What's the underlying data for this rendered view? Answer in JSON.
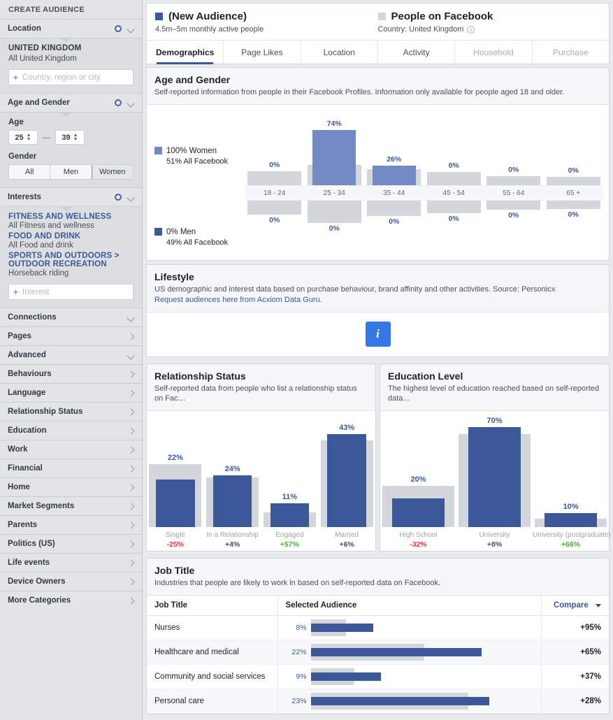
{
  "sidebar": {
    "title": "CREATE AUDIENCE",
    "location": {
      "label": "Location",
      "country_title": "UNITED KINGDOM",
      "country_sub": "All United Kingdom",
      "input_placeholder": "Country, region or city"
    },
    "age_gender": {
      "label": "Age and Gender",
      "age_label": "Age",
      "age_min": "25",
      "age_max": "39",
      "dash": "—",
      "gender_label": "Gender",
      "options": [
        "All",
        "Men",
        "Women"
      ],
      "selected": "Women"
    },
    "interests": {
      "label": "Interests",
      "groups": [
        {
          "category": "FITNESS AND WELLNESS",
          "item": "All Fitness and wellness"
        },
        {
          "category": "FOOD AND DRINK",
          "item": "All Food and drink"
        },
        {
          "category": "SPORTS AND OUTDOORS > OUTDOOR RECREATION",
          "item": "Horseback riding"
        }
      ],
      "input_placeholder": "Interest"
    },
    "sections": [
      {
        "label": "Connections",
        "chevron": "down"
      },
      {
        "label": "Pages",
        "chevron": "right"
      },
      {
        "label": "Advanced",
        "chevron": "down"
      },
      {
        "label": "Behaviours",
        "chevron": "right"
      },
      {
        "label": "Language",
        "chevron": "right"
      },
      {
        "label": "Relationship Status",
        "chevron": "right"
      },
      {
        "label": "Education",
        "chevron": "right"
      },
      {
        "label": "Work",
        "chevron": "right"
      },
      {
        "label": "Financial",
        "chevron": "right"
      },
      {
        "label": "Home",
        "chevron": "right"
      },
      {
        "label": "Market Segments",
        "chevron": "right"
      },
      {
        "label": "Parents",
        "chevron": "right"
      },
      {
        "label": "Politics (US)",
        "chevron": "right"
      },
      {
        "label": "Life events",
        "chevron": "right"
      },
      {
        "label": "Device Owners",
        "chevron": "right"
      },
      {
        "label": "More Categories",
        "chevron": "right"
      }
    ]
  },
  "header": {
    "audience_name": "(New Audience)",
    "audience_sub": "4.5m–5m monthly active people",
    "compare_name": "People on Facebook",
    "compare_sub": "Country: United Kingdom",
    "tabs": [
      {
        "label": "Demographics",
        "state": "active"
      },
      {
        "label": "Page Likes",
        "state": "normal"
      },
      {
        "label": "Location",
        "state": "normal"
      },
      {
        "label": "Activity",
        "state": "normal"
      },
      {
        "label": "Household",
        "state": "dim"
      },
      {
        "label": "Purchase",
        "state": "dim"
      }
    ]
  },
  "age_gender_card": {
    "title": "Age and Gender",
    "subtitle": "Self-reported information from people in their Facebook Profiles. Information only available for people aged 18 and older.",
    "legend_women": "100% Women",
    "legend_women_sub": "51% All Facebook",
    "legend_men": "0% Men",
    "legend_men_sub": "49% All Facebook"
  },
  "lifestyle": {
    "title": "Lifestyle",
    "subtitle": "US demographic and interest data based on purchase behaviour, brand affinity and other activities. Source: Personicx",
    "link": "Request audiences here from Acxiom Data Guru.",
    "button_icon": "info-icon"
  },
  "relationship_card": {
    "title": "Relationship Status",
    "subtitle": "Self-reported data from people who list a relationship status on Fac…"
  },
  "education_card": {
    "title": "Education Level",
    "subtitle": "The highest level of education reached based on self-reported data…"
  },
  "job_card": {
    "title": "Job Title",
    "subtitle": "Industries that people are likely to work in based on self-reported data on Facebook.",
    "columns": [
      "Job Title",
      "Selected Audience",
      "Compare"
    ],
    "rows": [
      {
        "title": "Nurses",
        "pct": "8%",
        "value": 8,
        "compare_value": 4,
        "compare": "+95%",
        "dir": "pos"
      },
      {
        "title": "Healthcare and medical",
        "pct": "22%",
        "value": 22,
        "compare_value": 13,
        "compare": "+65%",
        "dir": "pos"
      },
      {
        "title": "Community and social services",
        "pct": "9%",
        "value": 9,
        "compare_value": 5,
        "compare": "+37%",
        "dir": "pos"
      },
      {
        "title": "Personal care",
        "pct": "23%",
        "value": 23,
        "compare_value": 18,
        "compare": "+28%",
        "dir": "pos"
      }
    ]
  },
  "chart_data": [
    {
      "type": "bar",
      "name": "Age and Gender",
      "title": "Age and Gender",
      "orientation": "vertical-diverging",
      "categories": [
        "18 - 24",
        "25 - 34",
        "35 - 44",
        "45 - 54",
        "55 - 64",
        "65 +"
      ],
      "series": [
        {
          "name": "Women (Selected Audience)",
          "color": "#7289c4",
          "values": [
            0,
            74,
            26,
            0,
            0,
            0
          ],
          "labels": [
            "0%",
            "74%",
            "26%",
            "0%",
            "0%",
            "0%"
          ]
        },
        {
          "name": "Women (People on Facebook)",
          "color": "#d3d6da",
          "values": [
            15,
            22,
            17,
            14,
            10,
            9
          ]
        },
        {
          "name": "Men (Selected Audience)",
          "color": "#3b5998",
          "values": [
            0,
            0,
            0,
            0,
            0,
            0
          ],
          "labels": [
            "0%",
            "0%",
            "0%",
            "0%",
            "0%",
            "0%"
          ]
        },
        {
          "name": "Men (People on Facebook)",
          "color": "#d3d6da",
          "values": [
            15,
            24,
            17,
            14,
            10,
            9
          ]
        }
      ],
      "ylabel": "",
      "xlabel": "",
      "grid": false,
      "legend": "left"
    },
    {
      "type": "bar",
      "name": "Relationship Status",
      "title": "Relationship Status",
      "categories": [
        "Single",
        "In a Relationship",
        "Engaged",
        "Married"
      ],
      "series": [
        {
          "name": "Selected Audience",
          "color": "#3b5998",
          "values": [
            22,
            24,
            11,
            43
          ],
          "labels": [
            "22%",
            "24%",
            "11%",
            "43%"
          ]
        },
        {
          "name": "People on Facebook",
          "color": "#d3d6da",
          "values": [
            29,
            23,
            7,
            40
          ]
        }
      ],
      "deltas": [
        "-25%",
        "+4%",
        "+57%",
        "+6%"
      ],
      "delta_dirs": [
        "neg",
        "neu",
        "pos",
        "neu"
      ],
      "ylim": [
        0,
        50
      ],
      "grid": false
    },
    {
      "type": "bar",
      "name": "Education Level",
      "title": "Education Level",
      "categories": [
        "High School",
        "University",
        "University (postgraduate)"
      ],
      "series": [
        {
          "name": "Selected Audience",
          "color": "#3b5998",
          "values": [
            20,
            70,
            10
          ],
          "labels": [
            "20%",
            "70%",
            "10%"
          ]
        },
        {
          "name": "People on Facebook",
          "color": "#d3d6da",
          "values": [
            29,
            65,
            6
          ]
        }
      ],
      "deltas": [
        "-32%",
        "+8%",
        "+66%"
      ],
      "delta_dirs": [
        "neg",
        "neu",
        "pos"
      ],
      "ylim": [
        0,
        75
      ],
      "grid": false
    },
    {
      "type": "bar",
      "name": "Job Title",
      "title": "Job Title",
      "orientation": "horizontal",
      "categories": [
        "Nurses",
        "Healthcare and medical",
        "Community and social services",
        "Personal care"
      ],
      "series": [
        {
          "name": "Selected Audience",
          "color": "#3b5998",
          "values": [
            8,
            22,
            9,
            23
          ]
        },
        {
          "name": "People on Facebook",
          "color": "#d3d6da",
          "values": [
            4,
            13,
            5,
            18
          ]
        }
      ],
      "compare": [
        "+95%",
        "+65%",
        "+37%",
        "+28%"
      ]
    }
  ],
  "colors": {
    "brand": "#3b5998",
    "women": "#7289c4",
    "gray_bar": "#d3d6da",
    "positive": "#42b72a",
    "negative": "#f0373c",
    "link": "#3b5998",
    "info_button": "#3578e5"
  }
}
